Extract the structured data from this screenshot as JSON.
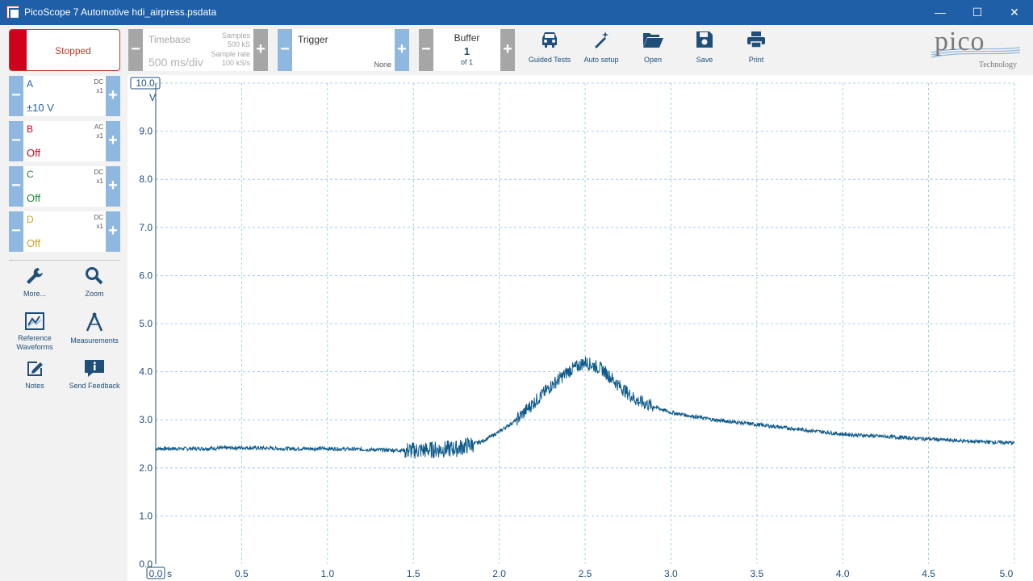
{
  "window": {
    "title": "PicoScope 7 Automotive hdi_airpress.psdata",
    "minimize": "—",
    "maximize": "☐",
    "close": "✕"
  },
  "toolbar": {
    "run_button": "Stopped",
    "timebase": {
      "label": "Timebase",
      "value": "500 ms/div",
      "samples_label": "Samples",
      "samples_value": "500 kS",
      "rate_label": "Sample rate",
      "rate_value": "100 kS/s"
    },
    "trigger": {
      "label": "Trigger",
      "mode": "None"
    },
    "buffer": {
      "label": "Buffer",
      "current": "1",
      "total": "of 1"
    },
    "tools": [
      {
        "label": "Guided Tests",
        "icon": "car-icon"
      },
      {
        "label": "Auto setup",
        "icon": "magic-wand-icon"
      },
      {
        "label": "Open",
        "icon": "folder-open-icon"
      },
      {
        "label": "Save",
        "icon": "floppy-disk-icon"
      },
      {
        "label": "Print",
        "icon": "printer-icon"
      }
    ],
    "logo": {
      "brand": "pico",
      "sub": "Technology"
    }
  },
  "channels": [
    {
      "name": "A",
      "coupling": "DC",
      "probe": "x1",
      "range": "±10 V",
      "color": "#1f5fa8"
    },
    {
      "name": "B",
      "coupling": "AC",
      "probe": "x1",
      "range": "Off",
      "color": "#d0021b"
    },
    {
      "name": "C",
      "coupling": "DC",
      "probe": "x1",
      "range": "Off",
      "color": "#1f8a3a"
    },
    {
      "name": "D",
      "coupling": "DC",
      "probe": "x1",
      "range": "Off",
      "color": "#c9a227"
    }
  ],
  "side_tools": [
    {
      "label": "More...",
      "icon": "wrench-icon"
    },
    {
      "label": "Zoom",
      "icon": "zoom-icon"
    },
    {
      "label": "Reference Waveforms",
      "icon": "reference-waveforms-icon"
    },
    {
      "label": "Measurements",
      "icon": "measurements-icon"
    },
    {
      "label": "Notes",
      "icon": "notes-icon"
    },
    {
      "label": "Send Feedback",
      "icon": "feedback-icon"
    }
  ],
  "chart_data": {
    "type": "line",
    "xlabel": "s",
    "ylabel": "V",
    "xlim": [
      0.0,
      5.0
    ],
    "ylim": [
      0.0,
      10.0
    ],
    "x_ticks": [
      "0.0",
      "0.5",
      "1.0",
      "1.5",
      "2.0",
      "2.5",
      "3.0",
      "3.5",
      "4.0",
      "4.5",
      "5.0"
    ],
    "y_ticks": [
      "0.0",
      "1.0",
      "2.0",
      "3.0",
      "4.0",
      "5.0",
      "6.0",
      "7.0",
      "8.0",
      "9.0",
      "10.0"
    ],
    "grid": true,
    "series": [
      {
        "color": "#0e5a8a",
        "x": [
          0.0,
          0.25,
          0.5,
          0.75,
          1.0,
          1.25,
          1.5,
          1.75,
          1.9,
          2.0,
          2.1,
          2.2,
          2.3,
          2.4,
          2.5,
          2.6,
          2.7,
          2.8,
          3.0,
          3.25,
          3.5,
          3.75,
          4.0,
          4.25,
          4.5,
          4.75,
          5.0
        ],
        "values": [
          2.4,
          2.4,
          2.42,
          2.4,
          2.4,
          2.38,
          2.36,
          2.4,
          2.55,
          2.75,
          3.0,
          3.35,
          3.7,
          4.0,
          4.2,
          4.05,
          3.7,
          3.4,
          3.15,
          3.0,
          2.9,
          2.8,
          2.7,
          2.65,
          2.6,
          2.55,
          2.52
        ]
      }
    ]
  }
}
